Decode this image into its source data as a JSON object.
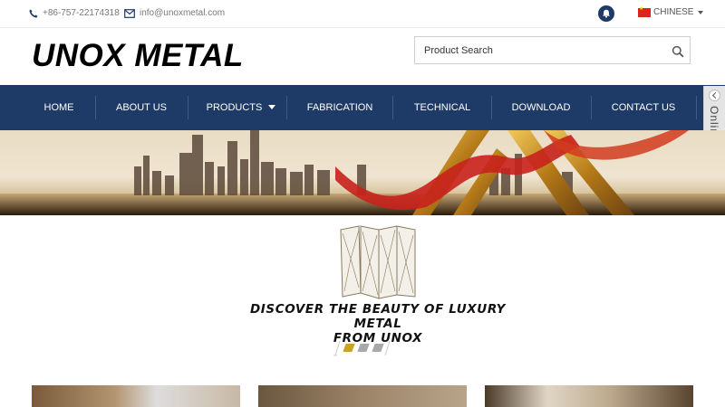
{
  "topbar": {
    "phone": "+86-757-22174318",
    "email": "info@unoxmetal.com",
    "language": "CHINESE",
    "icons": [
      "phone-icon",
      "email-icon",
      "notification-icon",
      "china-flag-icon"
    ]
  },
  "header": {
    "logo": "UNOX METAL",
    "search": {
      "placeholder": "Product Search",
      "value": ""
    }
  },
  "nav": {
    "items": [
      {
        "label": "HOME"
      },
      {
        "label": "ABOUT US"
      },
      {
        "label": "PRODUCTS",
        "has_dropdown": true
      },
      {
        "label": "FABRICATION"
      },
      {
        "label": "TECHNICAL"
      },
      {
        "label": "DOWNLOAD"
      },
      {
        "label": "CONTACT US"
      }
    ]
  },
  "online_service": {
    "label": "Online Service"
  },
  "feature": {
    "headline_line1": "DISCOVER THE BEAUTY OF LUXURY METAL",
    "headline_line2": "FROM UNOX",
    "slide_count": 3,
    "active_slide": 1
  },
  "colors": {
    "nav_bg": "#1e3a66",
    "accent_gold": "#c9a227",
    "dot_inactive": "#a8a8a8"
  }
}
